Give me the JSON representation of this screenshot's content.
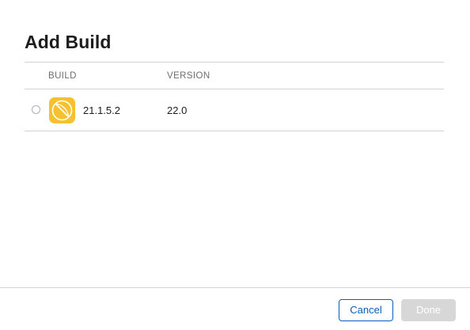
{
  "dialog": {
    "title": "Add Build"
  },
  "table": {
    "columns": {
      "build": "BUILD",
      "version": "VERSION"
    },
    "rows": [
      {
        "selected": false,
        "icon": "app-icon",
        "build": "21.1.5.2",
        "version": "22.0"
      }
    ]
  },
  "footer": {
    "cancel_label": "Cancel",
    "done_label": "Done",
    "done_enabled": false
  },
  "colors": {
    "accent": "#0b5dbb",
    "app_icon": "#f5c12e",
    "disabled_button": "#d7d7d7"
  }
}
